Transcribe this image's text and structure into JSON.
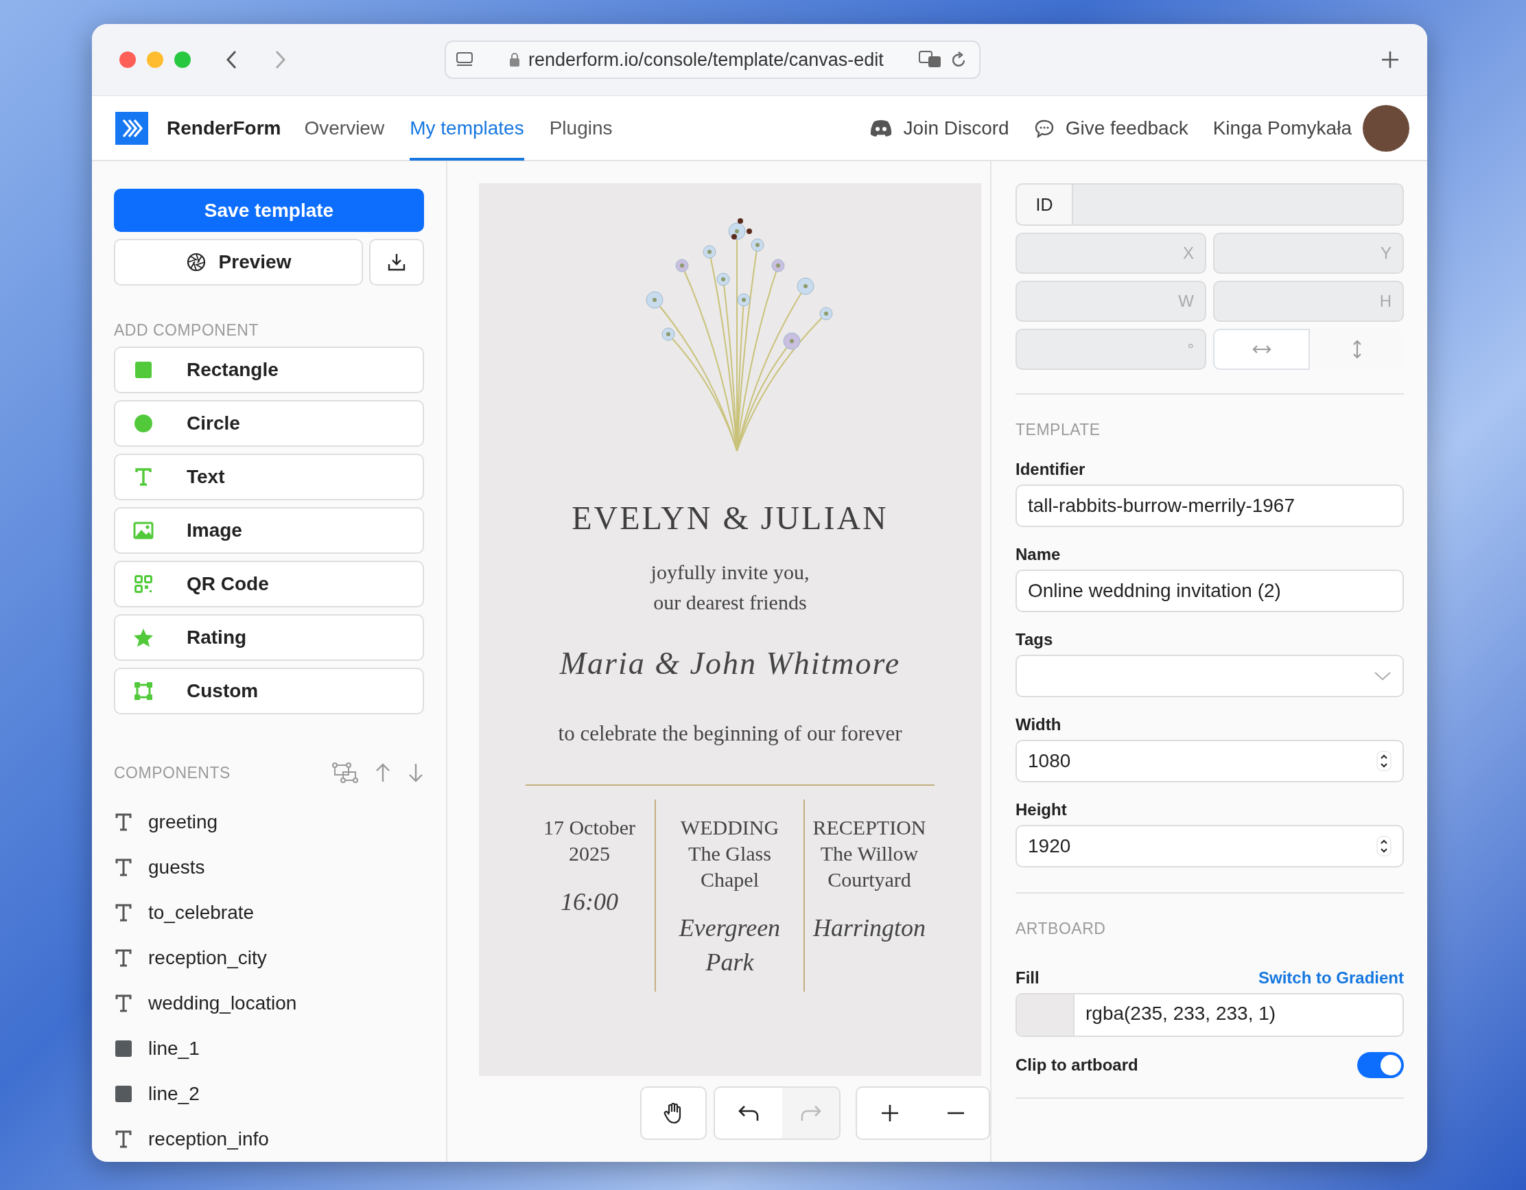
{
  "browser": {
    "url": "renderform.io/console/template/canvas-edit"
  },
  "nav": {
    "brand": "RenderForm",
    "links": [
      {
        "label": "Overview",
        "selected": false
      },
      {
        "label": "My templates",
        "selected": true
      },
      {
        "label": "Plugins",
        "selected": false
      }
    ],
    "actions": [
      {
        "label": "Join Discord",
        "kind": "discord"
      },
      {
        "label": "Give feedback",
        "kind": "feedback"
      }
    ],
    "user": "Kinga Pomykała"
  },
  "sidebar": {
    "save": "Save template",
    "preview": "Preview",
    "add_heading": "ADD COMPONENT",
    "add_items": [
      {
        "label": "Rectangle",
        "kind": "rectangle"
      },
      {
        "label": "Circle",
        "kind": "circle"
      },
      {
        "label": "Text",
        "kind": "text"
      },
      {
        "label": "Image",
        "kind": "image"
      },
      {
        "label": "QR Code",
        "kind": "qr"
      },
      {
        "label": "Rating",
        "kind": "rating"
      },
      {
        "label": "Custom",
        "kind": "custom"
      }
    ],
    "components_heading": "COMPONENTS",
    "components": [
      {
        "label": "greeting",
        "kind": "text"
      },
      {
        "label": "guests",
        "kind": "text"
      },
      {
        "label": "to_celebrate",
        "kind": "text"
      },
      {
        "label": "reception_city",
        "kind": "text"
      },
      {
        "label": "wedding_location",
        "kind": "text"
      },
      {
        "label": "line_1",
        "kind": "shape"
      },
      {
        "label": "line_2",
        "kind": "shape"
      },
      {
        "label": "reception_info",
        "kind": "text"
      }
    ]
  },
  "artboard": {
    "title": "EVELYN & JULIAN",
    "invite_lines": [
      "joyfully invite you,",
      "our dearest friends"
    ],
    "guests": "Maria & John Whitmore",
    "celebrate": "to celebrate the beginning of our forever",
    "columns": [
      {
        "lines": [
          "17 October",
          "2025"
        ],
        "script_lines": [
          "16:00"
        ]
      },
      {
        "lines": [
          "WEDDING",
          "The Glass",
          "Chapel"
        ],
        "script_lines": [
          "Evergreen",
          "Park"
        ]
      },
      {
        "lines": [
          "RECEPTION",
          "The Willow",
          "Courtyard"
        ],
        "script_lines": [
          "Harrington"
        ]
      }
    ]
  },
  "toolbar": [
    {
      "kind": "hand",
      "disabled": false
    },
    {
      "kind": "undo",
      "disabled": false
    },
    {
      "kind": "redo",
      "disabled": true
    },
    {
      "kind": "zoom-in",
      "disabled": false
    },
    {
      "kind": "zoom-out",
      "disabled": false
    }
  ],
  "inspector": {
    "id_label": "ID",
    "coords": [
      "X",
      "Y",
      "W",
      "H",
      "°"
    ],
    "template_heading": "TEMPLATE",
    "fields": [
      {
        "label": "Identifier",
        "value": "tall-rabbits-burrow-merrily-1967",
        "kind": "text"
      },
      {
        "label": "Name",
        "value": "Online weddning invitation (2)",
        "kind": "text"
      },
      {
        "label": "Tags",
        "kind": "select"
      },
      {
        "label": "Width",
        "value": "1080",
        "kind": "number"
      },
      {
        "label": "Height",
        "value": "1920",
        "kind": "number"
      }
    ],
    "artboard_heading": "ARTBOARD",
    "fill": {
      "label": "Fill",
      "link": "Switch to Gradient",
      "value": "rgba(235, 233, 233, 1)"
    },
    "clip": {
      "label": "Clip to artboard",
      "on": true
    }
  }
}
